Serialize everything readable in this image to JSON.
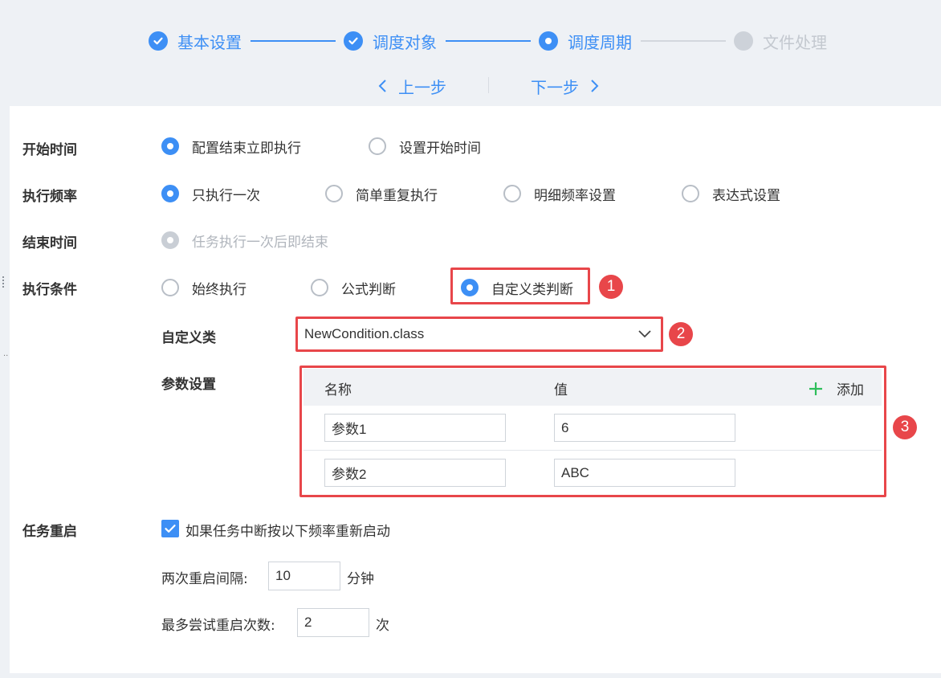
{
  "steps": [
    {
      "label": "基本设置",
      "state": "done"
    },
    {
      "label": "调度对象",
      "state": "done"
    },
    {
      "label": "调度周期",
      "state": "active"
    },
    {
      "label": "文件处理",
      "state": "todo"
    }
  ],
  "nav": {
    "prev_label": "上一步",
    "next_label": "下一步"
  },
  "colors": {
    "accent": "#3d8ff5",
    "highlight_red": "#e8464a",
    "add_green": "#2dbe5a"
  },
  "start_time": {
    "label": "开始时间",
    "options": [
      "配置结束立即执行",
      "设置开始时间"
    ],
    "selected": "配置结束立即执行"
  },
  "frequency": {
    "label": "执行频率",
    "options": [
      "只执行一次",
      "简单重复执行",
      "明细频率设置",
      "表达式设置"
    ],
    "selected": "只执行一次"
  },
  "end_time": {
    "label": "结束时间",
    "option": "任务执行一次后即结束"
  },
  "condition": {
    "label": "执行条件",
    "options": [
      "始终执行",
      "公式判断",
      "自定义类判断"
    ],
    "selected": "自定义类判断"
  },
  "custom_class": {
    "label": "自定义类",
    "value": "NewCondition.class"
  },
  "params": {
    "label": "参数设置",
    "headers": {
      "name": "名称",
      "value": "值",
      "add": "添加"
    },
    "rows": [
      {
        "name": "参数1",
        "value": "6"
      },
      {
        "name": "参数2",
        "value": "ABC"
      }
    ]
  },
  "restart": {
    "label": "任务重启",
    "checkbox_label": "如果任务中断按以下频率重新启动",
    "checked": true,
    "interval_label": "两次重启间隔:",
    "interval_value": "10",
    "interval_unit": "分钟",
    "max_label": "最多尝试重启次数:",
    "max_value": "2",
    "max_unit": "次"
  },
  "badges": [
    "1",
    "2",
    "3"
  ]
}
